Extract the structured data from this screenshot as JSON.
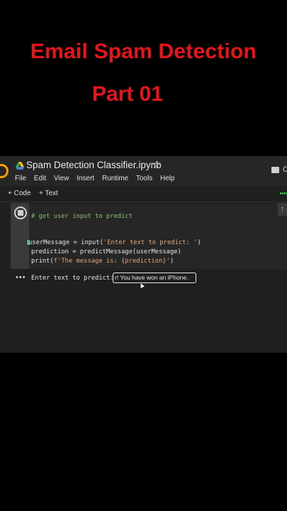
{
  "overlay": {
    "title_line1": "Email Spam Detection",
    "title_line2": "Part 01"
  },
  "notebook": {
    "name": "Spam Detection Classifier.ipynb",
    "star_icon": "star-icon",
    "menu": [
      "File",
      "Edit",
      "View",
      "Insert",
      "Runtime",
      "Tools",
      "Help"
    ],
    "comment_letter": "C"
  },
  "toolbar": {
    "add_code": "+ Code",
    "add_text": "+ Text"
  },
  "cell": {
    "comment": "# get user input to predict",
    "line1_pre": "userMessage = input(",
    "line1_str": "'Enter text to predict: '",
    "line1_post": ")",
    "line2": "prediction = predictMessage(userMessage)",
    "line3_pre": "print(",
    "line3_str": "f'The message is: {prediction}'",
    "line3_post": ")"
  },
  "output": {
    "menu": "•••",
    "prompt": "Enter text to predict:",
    "input_value": "r! You have won an iPhone."
  },
  "colors": {
    "title_red": "#e8141c",
    "colab_bg": "#1f1f1f",
    "accent_orange": "#f5a000"
  }
}
